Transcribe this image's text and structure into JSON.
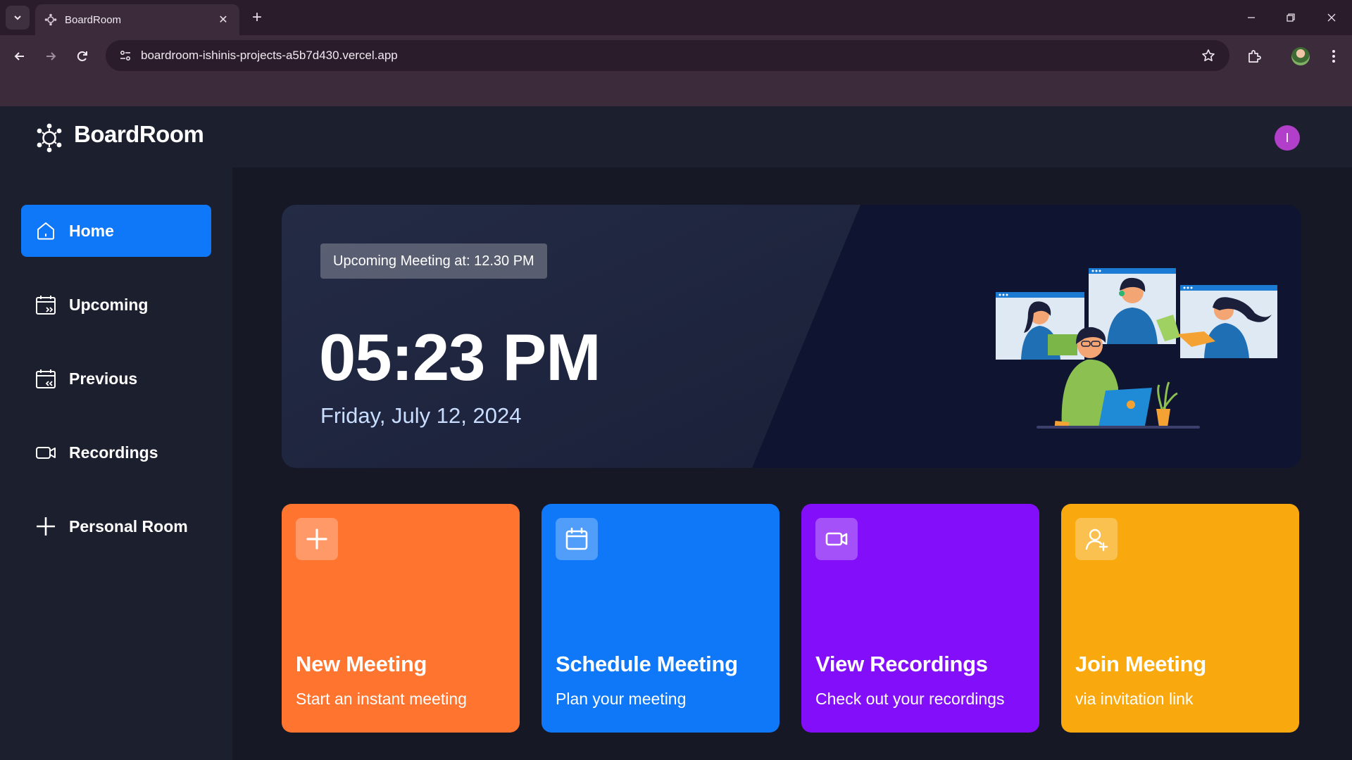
{
  "browser": {
    "tab_title": "BoardRoom",
    "url": "boardroom-ishinis-projects-a5b7d430.vercel.app"
  },
  "app": {
    "brand": "BoardRoom",
    "user_initial": "I",
    "colors": {
      "primary": "#0e78f9",
      "orange": "#ff742e",
      "blue": "#0e78f9",
      "purple": "#830ef9",
      "yellow": "#f9a90e"
    }
  },
  "sidebar": {
    "items": [
      {
        "label": "Home",
        "icon": "home-icon",
        "active": true
      },
      {
        "label": "Upcoming",
        "icon": "calendar-upcoming-icon"
      },
      {
        "label": "Previous",
        "icon": "calendar-previous-icon"
      },
      {
        "label": "Recordings",
        "icon": "video-icon"
      },
      {
        "label": "Personal Room",
        "icon": "plus-icon"
      }
    ]
  },
  "hero": {
    "badge": "Upcoming Meeting at: 12.30 PM",
    "time": "05:23 PM",
    "date": "Friday, July 12, 2024"
  },
  "cards": [
    {
      "title": "New Meeting",
      "subtitle": "Start an instant meeting",
      "icon": "plus-icon"
    },
    {
      "title": "Schedule Meeting",
      "subtitle": "Plan your meeting",
      "icon": "calendar-icon"
    },
    {
      "title": "View Recordings",
      "subtitle": "Check out your recordings",
      "icon": "video-icon"
    },
    {
      "title": "Join Meeting",
      "subtitle": "via invitation link",
      "icon": "user-add-icon"
    }
  ]
}
